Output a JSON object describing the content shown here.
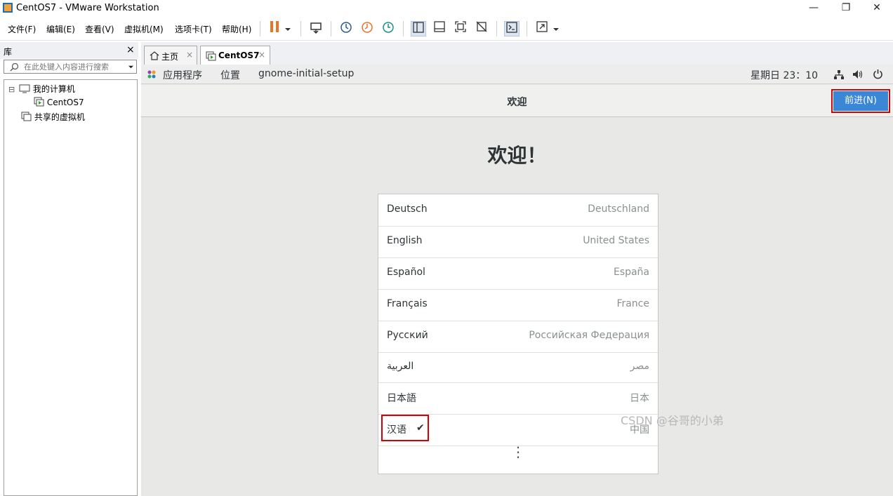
{
  "window": {
    "title": "CentOS7 - VMware Workstation",
    "minimize": "—",
    "restore": "❐",
    "close": "✕"
  },
  "menu": [
    "文件(F)",
    "编辑(E)",
    "查看(V)",
    "虚拟机(M)",
    "选项卡(T)",
    "帮助(H)"
  ],
  "library": {
    "title": "库",
    "close": "×",
    "search_placeholder": "在此处键入内容进行搜索",
    "tree": {
      "my_computer": "我的计算机",
      "vm": "CentOS7",
      "shared": "共享的虚拟机",
      "collapse": "⊟"
    }
  },
  "tabs": [
    {
      "label": "主页",
      "close": "×"
    },
    {
      "label": "CentOS7",
      "close": "×"
    }
  ],
  "gnome": {
    "applications": "应用程序",
    "places": "位置",
    "app_name": "gnome-initial-setup",
    "clock": "星期日 23：10"
  },
  "setup": {
    "header_title": "欢迎",
    "next_button": "前进(N)",
    "welcome": "欢迎！",
    "languages": [
      {
        "name": "Deutsch",
        "region": "Deutschland"
      },
      {
        "name": "English",
        "region": "United States"
      },
      {
        "name": "Español",
        "region": "España"
      },
      {
        "name": "Français",
        "region": "France"
      },
      {
        "name": "Русский",
        "region": "Российская Федерация"
      },
      {
        "name": "العربية",
        "region": "مصر"
      },
      {
        "name": "日本語",
        "region": "日本"
      },
      {
        "name": "汉语",
        "region": "中国",
        "selected": true
      }
    ],
    "selected_mark": "✔",
    "more": "⋮"
  },
  "watermark": "CSDN @谷哥的小弟",
  "colors": {
    "accent": "#3a87d8",
    "highlight_border": "#d60000",
    "pause": "#e8742a"
  }
}
